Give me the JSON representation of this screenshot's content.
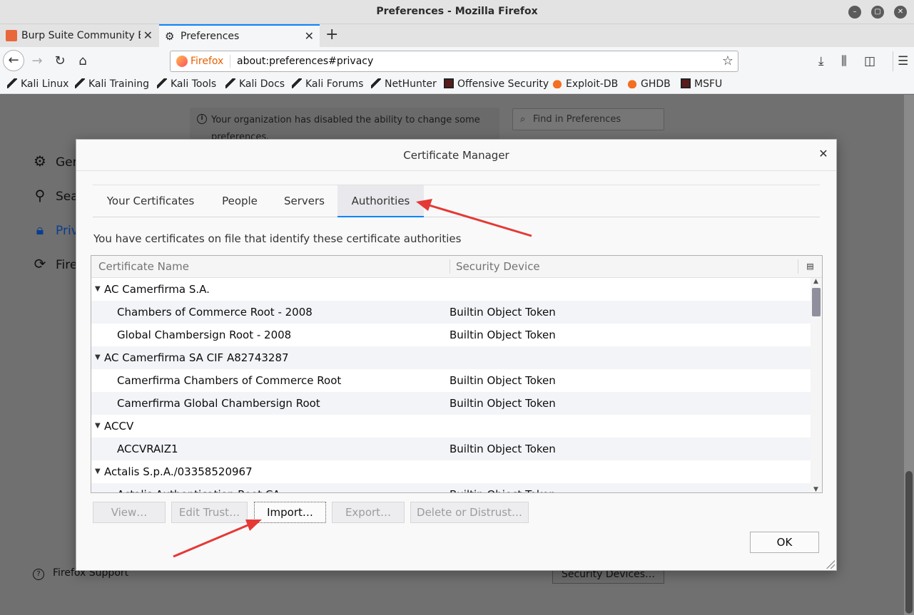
{
  "window": {
    "title": "Preferences - Mozilla Firefox"
  },
  "tabs": [
    {
      "label": "Burp Suite Community Ed",
      "active": false
    },
    {
      "label": "Preferences",
      "active": true
    }
  ],
  "navbar": {
    "brand": "Firefox",
    "url": "about:preferences#privacy"
  },
  "bookmarks": [
    {
      "label": "Kali Linux",
      "icon": "kali-dragon-icon"
    },
    {
      "label": "Kali Training",
      "icon": "kali-dragon-icon"
    },
    {
      "label": "Kali Tools",
      "icon": "kali-dragon-icon"
    },
    {
      "label": "Kali Docs",
      "icon": "kali-dragon-icon"
    },
    {
      "label": "Kali Forums",
      "icon": "kali-dragon-icon"
    },
    {
      "label": "NetHunter",
      "icon": "kali-dragon-icon"
    },
    {
      "label": "Offensive Security",
      "icon": "offsec-icon"
    },
    {
      "label": "Exploit-DB",
      "icon": "exploitdb-icon"
    },
    {
      "label": "GHDB",
      "icon": "exploitdb-icon"
    },
    {
      "label": "MSFU",
      "icon": "offsec-icon"
    }
  ],
  "page": {
    "notice": "Your organization has disabled the ability to change some preferences.",
    "find_placeholder": "Find in Preferences",
    "sidebar": [
      {
        "label": "Gen",
        "icon": "gear-icon"
      },
      {
        "label": "Sea",
        "icon": "search-icon"
      },
      {
        "label": "Priv",
        "icon": "lock-icon"
      },
      {
        "label": "Fire",
        "icon": "sync-icon"
      }
    ],
    "support": "Firefox Support",
    "security_devices": "Security Devices…"
  },
  "dialog": {
    "title": "Certificate Manager",
    "tabs": [
      "Your Certificates",
      "People",
      "Servers",
      "Authorities"
    ],
    "active_tab": "Authorities",
    "description": "You have certificates on file that identify these certificate authorities",
    "columns": [
      "Certificate Name",
      "Security Device"
    ],
    "rows": [
      {
        "type": "group",
        "name": "AC Camerfirma S.A.",
        "device": ""
      },
      {
        "type": "item",
        "name": "Chambers of Commerce Root - 2008",
        "device": "Builtin Object Token"
      },
      {
        "type": "item",
        "name": "Global Chambersign Root - 2008",
        "device": "Builtin Object Token"
      },
      {
        "type": "group",
        "name": "AC Camerfirma SA CIF A82743287",
        "device": ""
      },
      {
        "type": "item",
        "name": "Camerfirma Chambers of Commerce Root",
        "device": "Builtin Object Token"
      },
      {
        "type": "item",
        "name": "Camerfirma Global Chambersign Root",
        "device": "Builtin Object Token"
      },
      {
        "type": "group",
        "name": "ACCV",
        "device": ""
      },
      {
        "type": "item",
        "name": "ACCVRAIZ1",
        "device": "Builtin Object Token"
      },
      {
        "type": "group",
        "name": "Actalis S.p.A./03358520967",
        "device": ""
      },
      {
        "type": "item",
        "name": "Actalis Authentication Root CA",
        "device": "Builtin Object Token"
      }
    ],
    "buttons": {
      "view": "View…",
      "edit_trust": "Edit Trust…",
      "import": "Import…",
      "export": "Export…",
      "delete": "Delete or Distrust…",
      "ok": "OK"
    }
  },
  "colors": {
    "accent": "#0a84ff",
    "arrow": "#e53935"
  }
}
